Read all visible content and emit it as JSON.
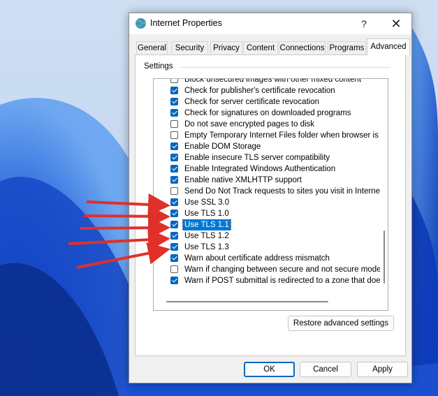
{
  "window": {
    "title": "Internet Properties",
    "help_label": "?",
    "close_label": "✕",
    "icon": "globe-icon"
  },
  "tabs": [
    {
      "label": "General",
      "active": false
    },
    {
      "label": "Security",
      "active": false
    },
    {
      "label": "Privacy",
      "active": false
    },
    {
      "label": "Content",
      "active": false
    },
    {
      "label": "Connections",
      "active": false
    },
    {
      "label": "Programs",
      "active": false
    },
    {
      "label": "Advanced",
      "active": true
    }
  ],
  "settings": {
    "group_label": "Settings",
    "items": [
      {
        "label": "Block unsecured images with other mixed content",
        "checked": false,
        "selected": false
      },
      {
        "label": "Check for publisher's certificate revocation",
        "checked": true,
        "selected": false
      },
      {
        "label": "Check for server certificate revocation",
        "checked": true,
        "selected": false
      },
      {
        "label": "Check for signatures on downloaded programs",
        "checked": true,
        "selected": false
      },
      {
        "label": "Do not save encrypted pages to disk",
        "checked": false,
        "selected": false
      },
      {
        "label": "Empty Temporary Internet Files folder when browser is clo",
        "checked": false,
        "selected": false
      },
      {
        "label": "Enable DOM Storage",
        "checked": true,
        "selected": false
      },
      {
        "label": "Enable insecure TLS server compatibility",
        "checked": true,
        "selected": false
      },
      {
        "label": "Enable Integrated Windows Authentication",
        "checked": true,
        "selected": false
      },
      {
        "label": "Enable native XMLHTTP support",
        "checked": true,
        "selected": false
      },
      {
        "label": "Send Do Not Track requests to sites you visit in Internet E",
        "checked": false,
        "selected": false
      },
      {
        "label": "Use SSL 3.0",
        "checked": true,
        "selected": false
      },
      {
        "label": "Use TLS 1.0",
        "checked": true,
        "selected": false
      },
      {
        "label": "Use TLS 1.1",
        "checked": true,
        "selected": true
      },
      {
        "label": "Use TLS 1.2",
        "checked": true,
        "selected": false
      },
      {
        "label": "Use TLS 1.3",
        "checked": true,
        "selected": false
      },
      {
        "label": "Warn about certificate address mismatch",
        "checked": true,
        "selected": false
      },
      {
        "label": "Warn if changing between secure and not secure mode",
        "checked": false,
        "selected": false
      },
      {
        "label": "Warn if POST submittal is redirected to a zone that does n",
        "checked": true,
        "selected": false
      }
    ]
  },
  "buttons": {
    "restore": "Restore advanced settings",
    "ok": "OK",
    "cancel": "Cancel",
    "apply": "Apply"
  },
  "colors": {
    "accent": "#0067c0",
    "annotation_arrow": "#e0302a"
  }
}
